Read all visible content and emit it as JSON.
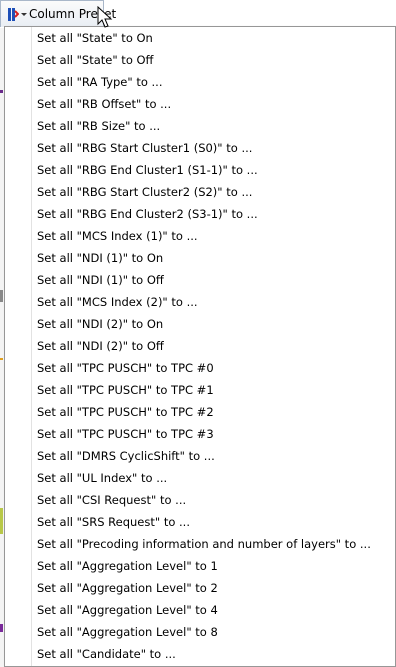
{
  "toolbar": {
    "label": "Column Preset",
    "icon": "column-preset-icon"
  },
  "colors": {
    "menu_border": "#979797",
    "menu_background": "#ffffff",
    "toolbar_border": "#a9b7c9",
    "icon_blue": "#1d4fb8",
    "icon_red": "#d81e1e"
  },
  "menu": {
    "items": [
      "Set all \"State\" to On",
      "Set all \"State\" to Off",
      "Set all \"RA Type\" to ...",
      "Set all \"RB Offset\" to ...",
      "Set all \"RB Size\" to ...",
      "Set all \"RBG Start Cluster1 (S0)\" to ...",
      "Set all \"RBG End Cluster1 (S1-1)\" to ...",
      "Set all \"RBG Start Cluster2 (S2)\" to ...",
      "Set all \"RBG End Cluster2 (S3-1)\" to ...",
      "Set all \"MCS Index (1)\" to ...",
      "Set all \"NDI (1)\" to On",
      "Set all \"NDI (1)\" to Off",
      "Set all \"MCS Index (2)\" to ...",
      "Set all \"NDI (2)\" to On",
      "Set all \"NDI (2)\" to Off",
      "Set all \"TPC PUSCH\" to TPC #0",
      "Set all \"TPC PUSCH\" to TPC #1",
      "Set all \"TPC PUSCH\" to TPC #2",
      "Set all \"TPC PUSCH\" to TPC #3",
      "Set all \"DMRS CyclicShift\" to ...",
      "Set all \"UL Index\" to ...",
      "Set all \"CSI Request\" to ...",
      "Set all \"SRS Request\" to ...",
      "Set all \"Precoding information and number of layers\" to ...",
      "Set all \"Aggregation Level\" to 1",
      "Set all \"Aggregation Level\" to 2",
      "Set all \"Aggregation Level\" to 4",
      "Set all \"Aggregation Level\" to 8",
      "Set all \"Candidate\" to ..."
    ]
  }
}
